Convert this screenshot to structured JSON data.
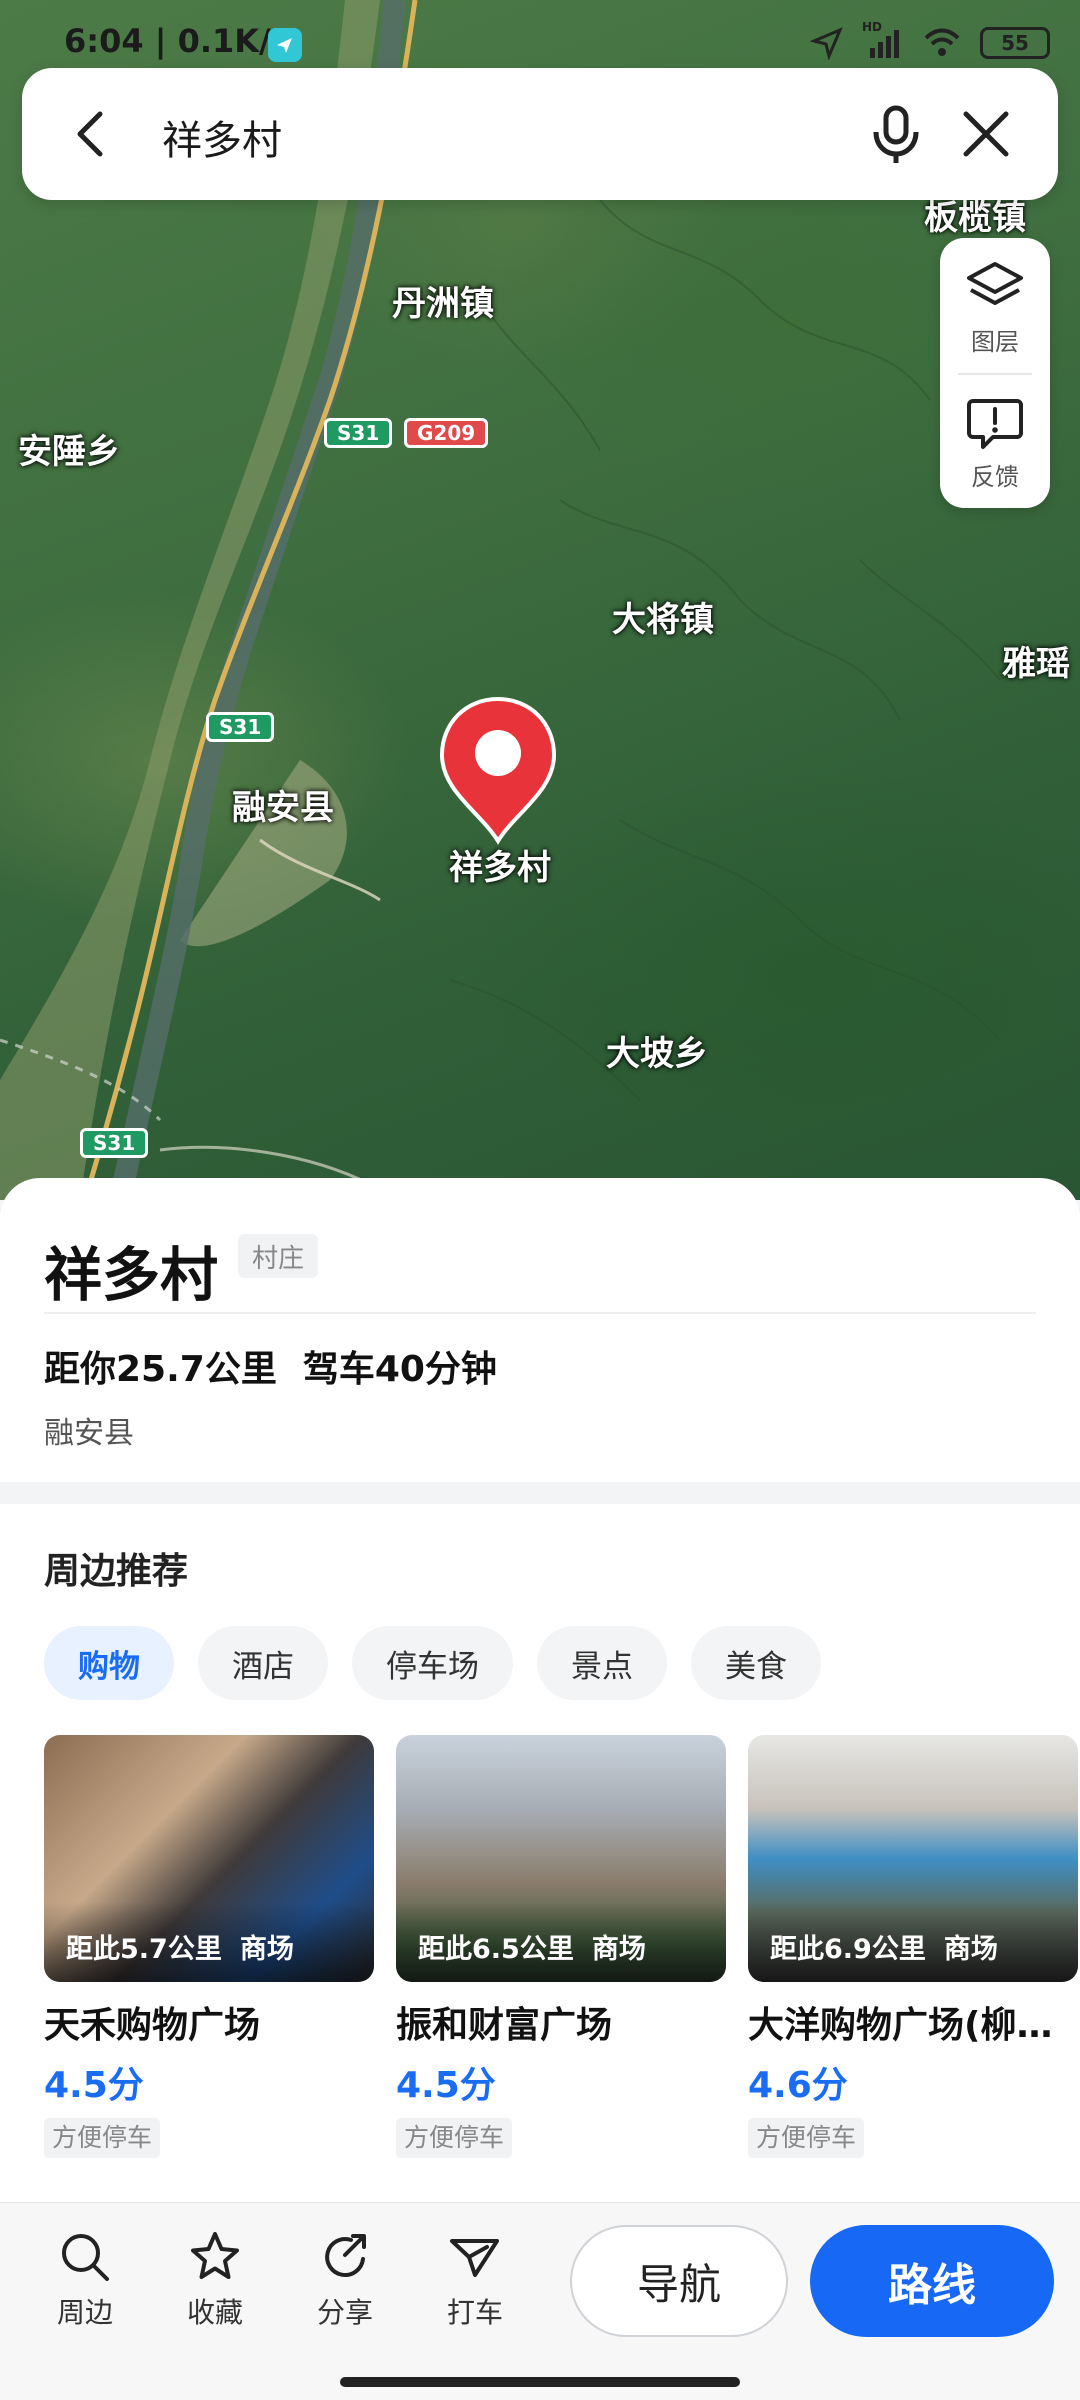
{
  "status_bar": {
    "time_speed": "6:04 | 0.1K/s",
    "battery": "55",
    "network": "HD"
  },
  "search": {
    "query": "祥多村"
  },
  "map": {
    "places": [
      "板榄镇",
      "丹洲镇",
      "安陲乡",
      "大将镇",
      "雅瑶",
      "融安县",
      "大坡乡"
    ],
    "roads": {
      "s31": "S31",
      "g209": "G209"
    },
    "pin_label": "祥多村",
    "controls": {
      "layers": "图层",
      "feedback": "反馈"
    }
  },
  "poi": {
    "name": "祥多村",
    "tag": "村庄",
    "distance": "距你25.7公里",
    "drive": "驾车40分钟",
    "region": "融安县"
  },
  "nearby": {
    "title": "周边推荐",
    "chips": [
      "购物",
      "酒店",
      "停车场",
      "景点",
      "美食"
    ],
    "active_chip": "购物",
    "cards": [
      {
        "distance": "距此5.7公里",
        "type": "商场",
        "name": "天禾购物广场",
        "score": "4.5分",
        "tag": "方便停车"
      },
      {
        "distance": "距此6.5公里",
        "type": "商场",
        "name": "振和财富广场",
        "score": "4.5分",
        "tag": "方便停车"
      },
      {
        "distance": "距此6.9公里",
        "type": "商场",
        "name": "大洋购物广场(柳…",
        "score": "4.6分",
        "tag": "方便停车"
      }
    ]
  },
  "toolbar": {
    "nearby": "周边",
    "favorite": "收藏",
    "share": "分享",
    "taxi": "打车",
    "navigate": "导航",
    "route": "路线"
  },
  "colors": {
    "accent": "#1769f5",
    "pin": "#e8333a",
    "road_s": "#1f9a62",
    "road_g": "#e04a4a"
  }
}
